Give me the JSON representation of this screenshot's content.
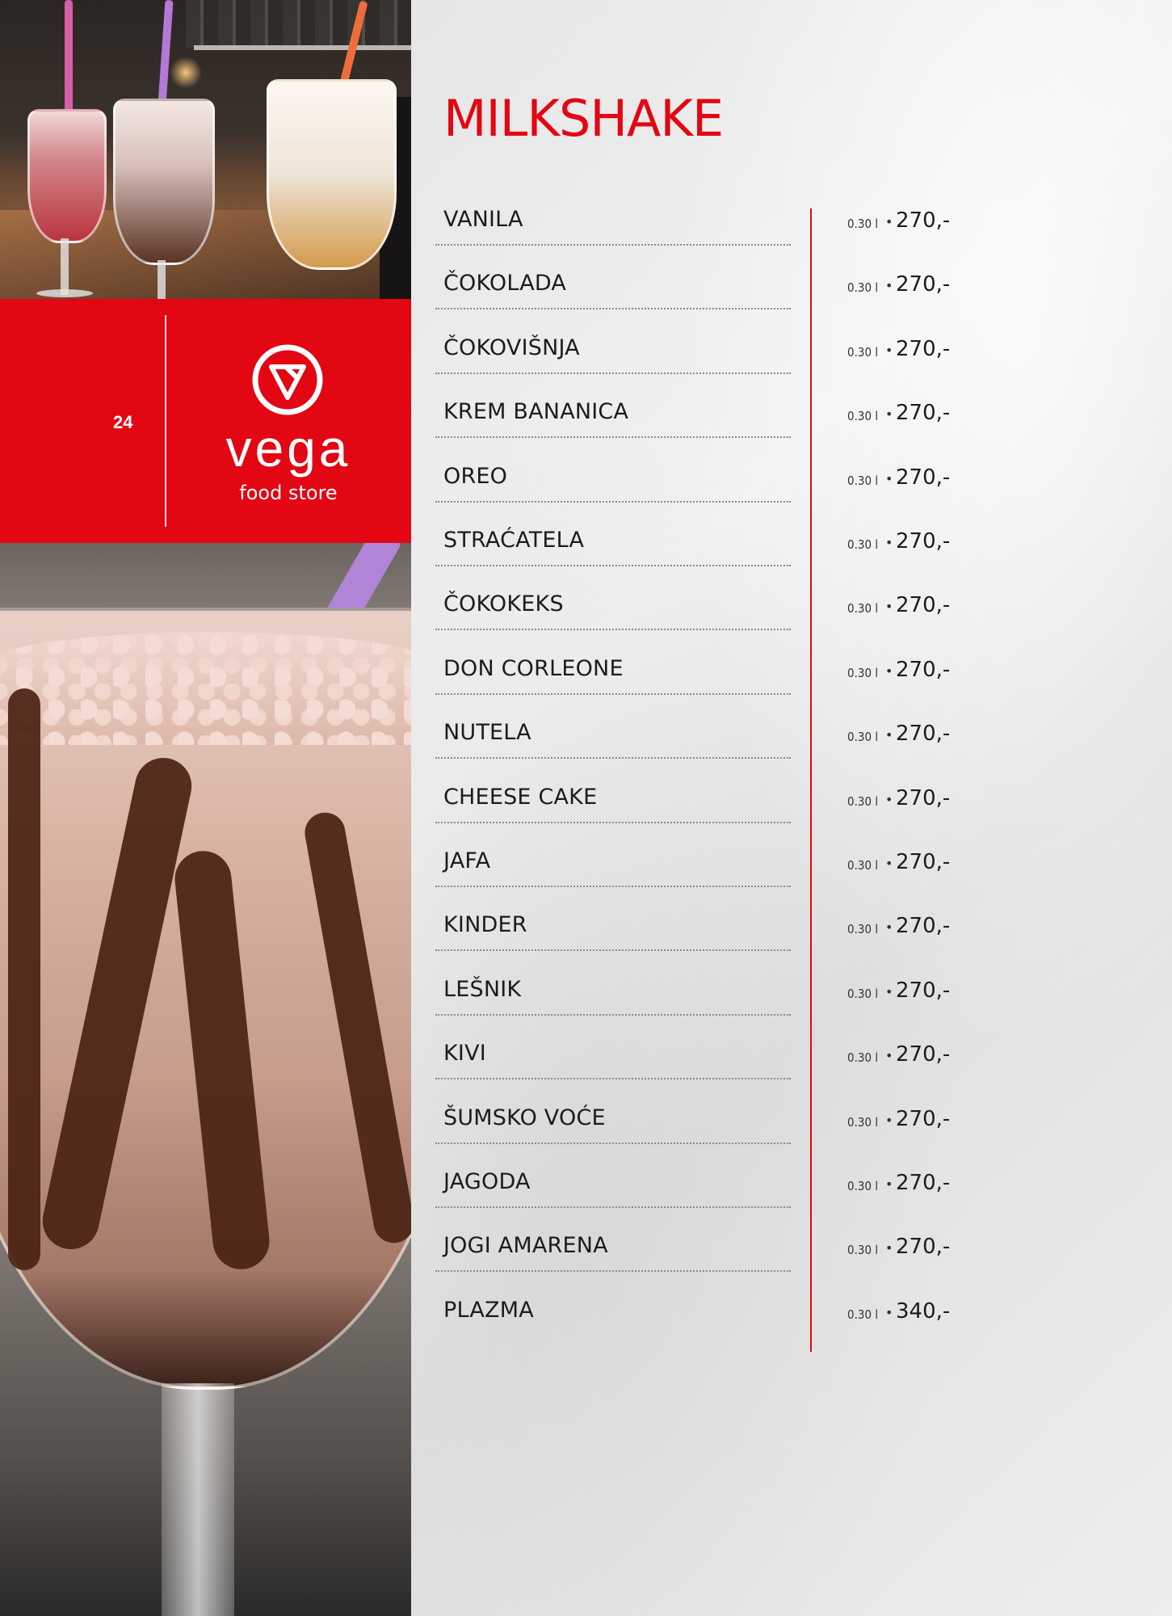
{
  "page": {
    "number": "24",
    "brand": {
      "name": "vega",
      "tagline": "food store"
    },
    "colors": {
      "accent": "#e30613",
      "text": "#1c1c1c"
    }
  },
  "menu": {
    "title": "MILKSHAKE",
    "items": [
      {
        "name": "VANILA",
        "volume": "0.30 l",
        "price": "270,-"
      },
      {
        "name": "ČOKOLADA",
        "volume": "0.30 l",
        "price": "270,-"
      },
      {
        "name": "ČOKOVIŠNJA",
        "volume": "0.30 l",
        "price": "270,-"
      },
      {
        "name": "KREM BANANICA",
        "volume": "0.30 l",
        "price": "270,-"
      },
      {
        "name": "OREO",
        "volume": "0.30 l",
        "price": "270,-"
      },
      {
        "name": "STRAĆATELA",
        "volume": "0.30 l",
        "price": "270,-"
      },
      {
        "name": "ČOKOKEKS",
        "volume": "0.30 l",
        "price": "270,-"
      },
      {
        "name": "DON CORLEONE",
        "volume": "0.30 l",
        "price": "270,-"
      },
      {
        "name": "NUTELA",
        "volume": "0.30 l",
        "price": "270,-"
      },
      {
        "name": "CHEESE CAKE",
        "volume": "0.30 l",
        "price": "270,-"
      },
      {
        "name": "JAFA",
        "volume": "0.30 l",
        "price": "270,-"
      },
      {
        "name": "KINDER",
        "volume": "0.30 l",
        "price": "270,-"
      },
      {
        "name": "LEŠNIK",
        "volume": "0.30 l",
        "price": "270,-"
      },
      {
        "name": "KIVI",
        "volume": "0.30 l",
        "price": "270,-"
      },
      {
        "name": "ŠUMSKO VOĆE",
        "volume": "0.30 l",
        "price": "270,-"
      },
      {
        "name": "JAGODA",
        "volume": "0.30 l",
        "price": "270,-"
      },
      {
        "name": "JOGI AMARENA",
        "volume": "0.30 l",
        "price": "270,-"
      },
      {
        "name": "PLAZMA",
        "volume": "0.30 l",
        "price": "340,-"
      }
    ]
  },
  "images": {
    "top_photo": "milkshakes-on-bar-photo",
    "bottom_photo": "chocolate-milkshake-glass-photo",
    "logo_icon": "vega-logo-icon"
  }
}
